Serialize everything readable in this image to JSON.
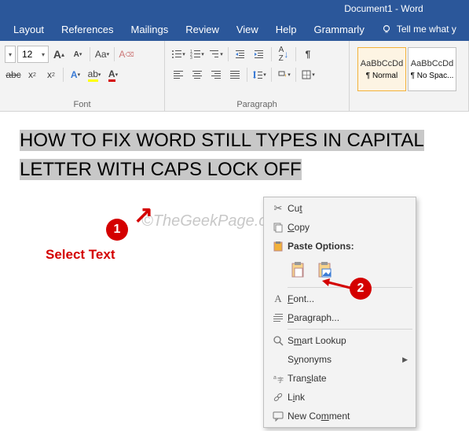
{
  "titlebar": {
    "title": "Document1 - Word"
  },
  "tabs": {
    "layout": "Layout",
    "references": "References",
    "mailings": "Mailings",
    "review": "Review",
    "view": "View",
    "help": "Help",
    "grammarly": "Grammarly",
    "tellme": "Tell me what y"
  },
  "ribbon": {
    "font": {
      "size": "12",
      "group_label": "Font"
    },
    "para": {
      "group_label": "Paragraph"
    },
    "styles": {
      "normal_prev": "AaBbCcDd",
      "normal_name": "¶ Normal",
      "nospac_prev": "AaBbCcDd",
      "nospac_name": "¶ No Spac..."
    }
  },
  "document": {
    "selected_text": "HOW TO FIX WORD STILL TYPES IN CAPITAL LETTER WITH CAPS LOCK OFF"
  },
  "watermark": "©TheGeekPage.com",
  "annotations": {
    "n1": "1",
    "n2": "2",
    "select_text": "Select Text"
  },
  "context_menu": {
    "cut": "Cut",
    "copy": "Copy",
    "paste_options": "Paste Options:",
    "font": "Font...",
    "paragraph": "Paragraph...",
    "smart_lookup": "Smart Lookup",
    "synonyms": "Synonyms",
    "translate": "Translate",
    "link": "Link",
    "new_comment": "New Comment"
  }
}
